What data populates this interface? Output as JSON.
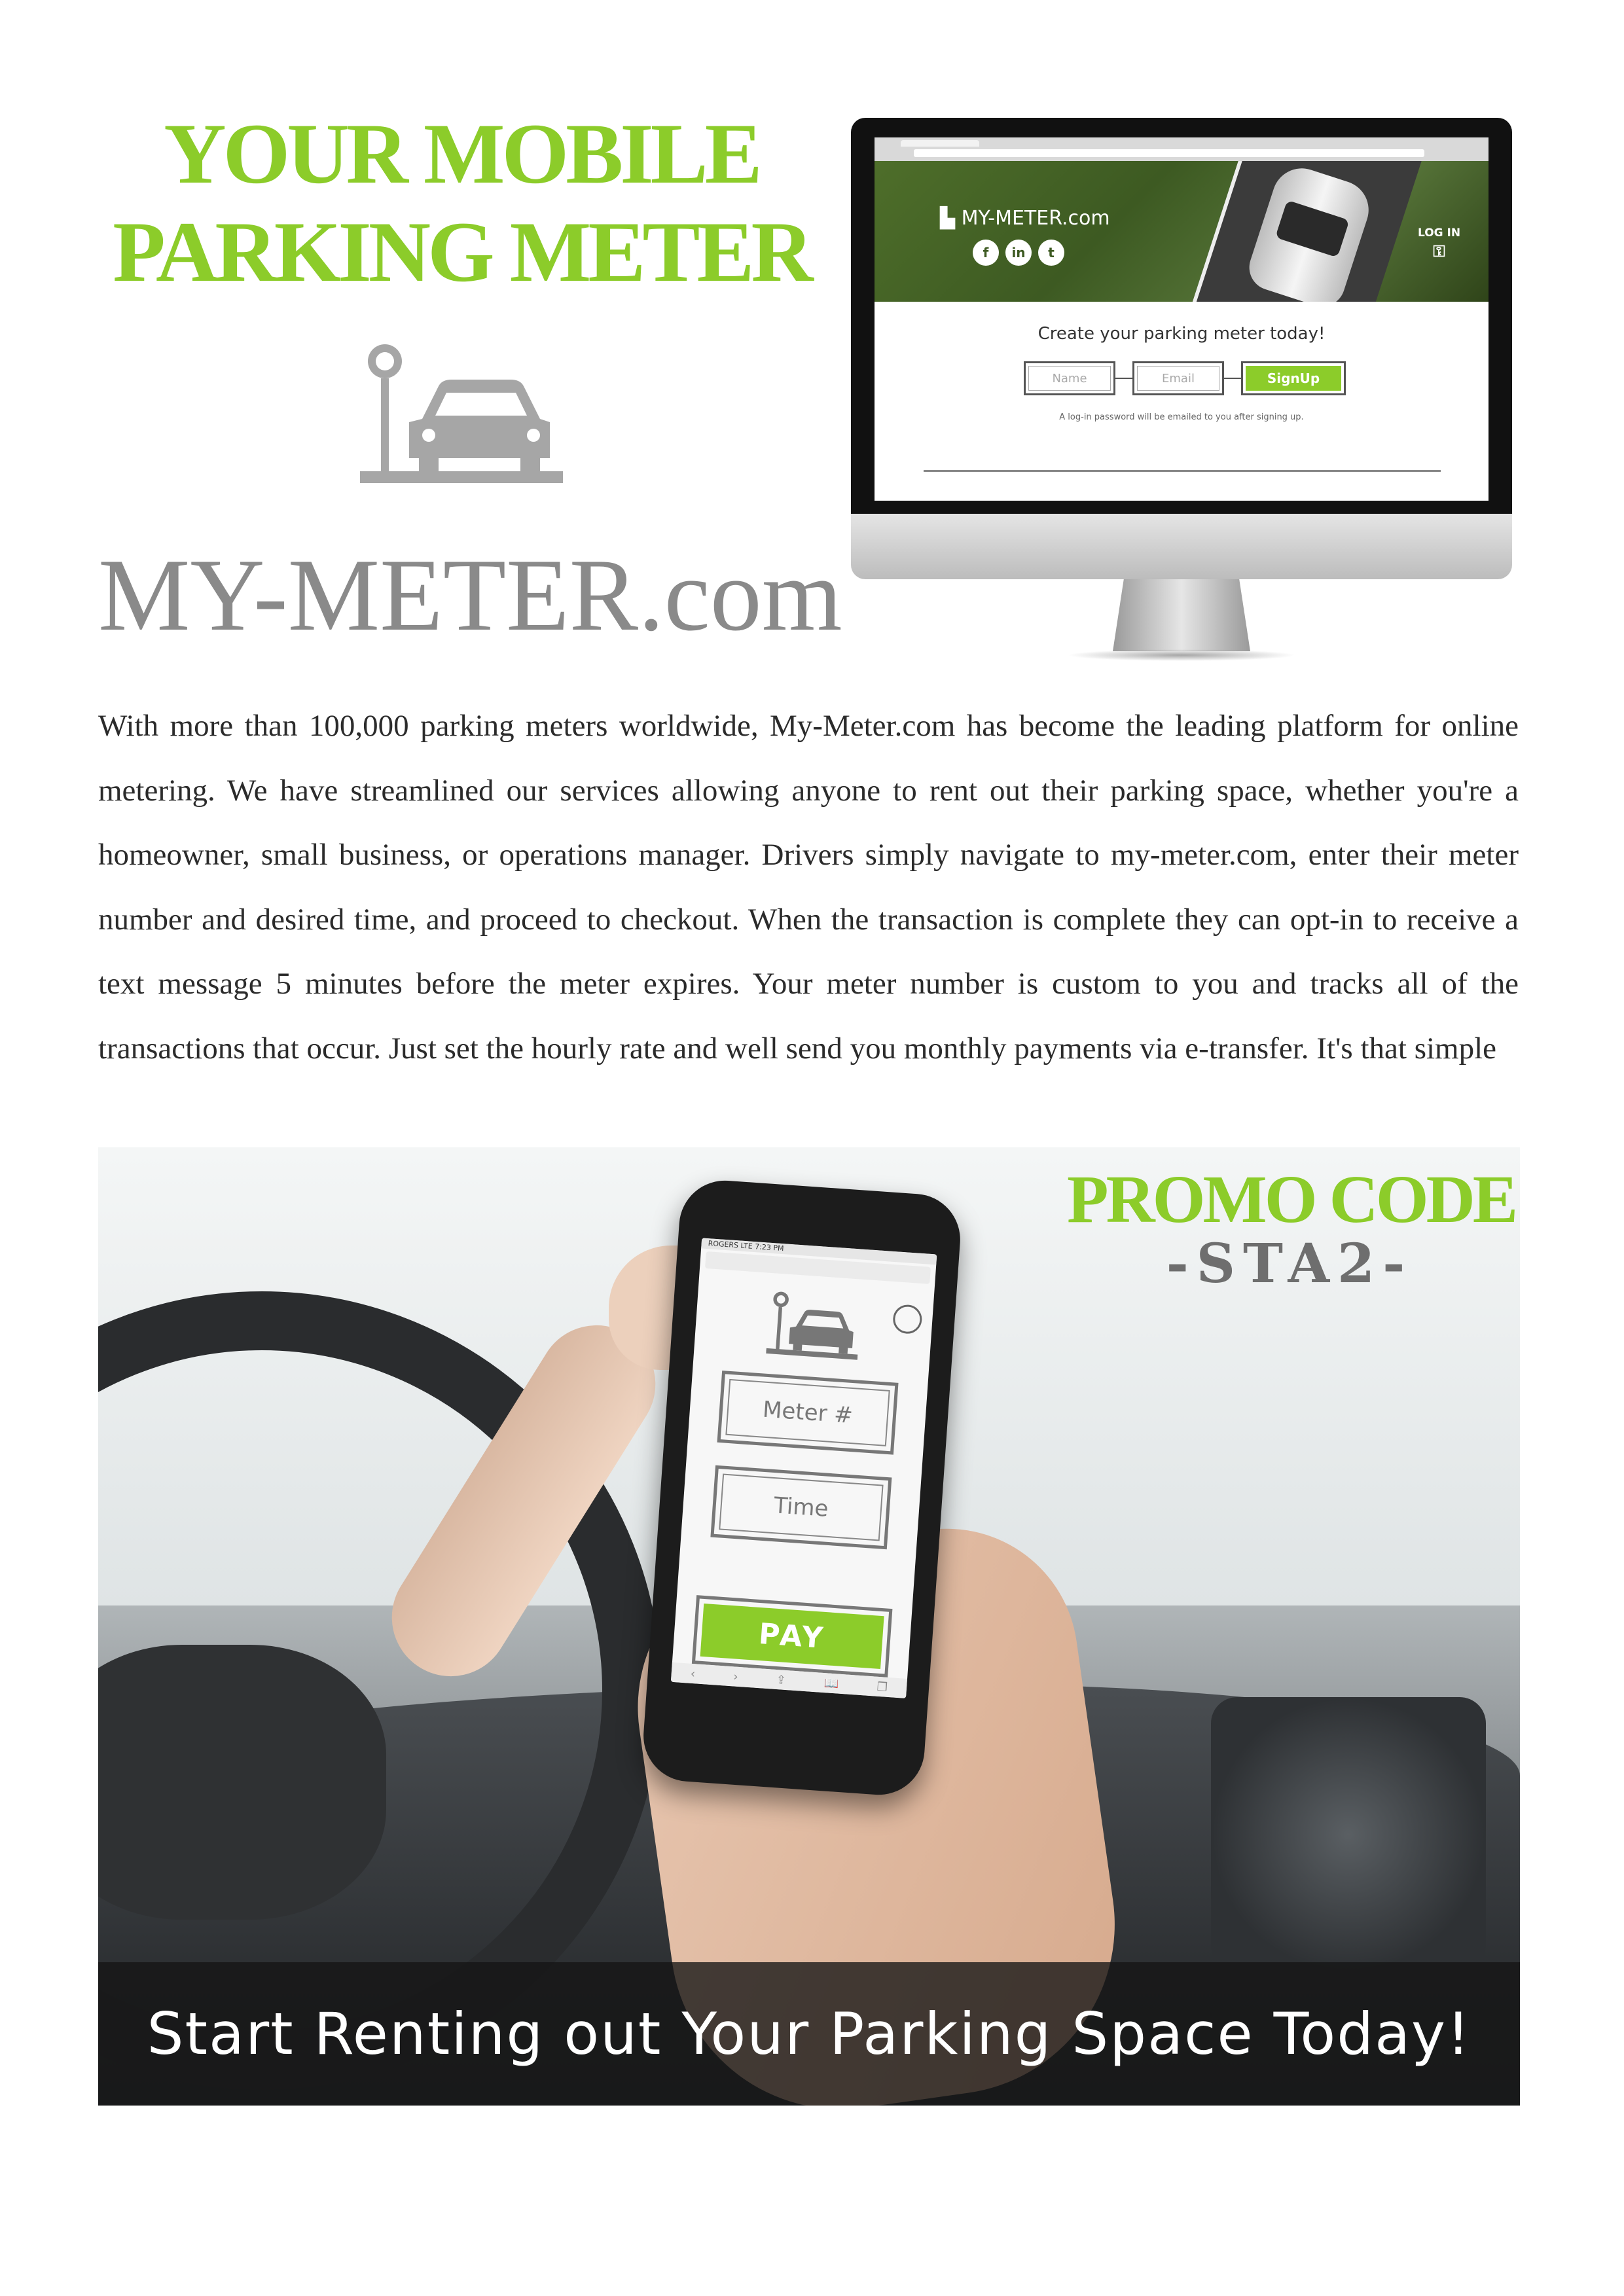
{
  "header": {
    "headline_line1": "YOUR MOBILE",
    "headline_line2": "PARKING METER",
    "brand": "MY-METER.com",
    "logo_icon": "parking-meter-car-icon"
  },
  "monitor_site": {
    "logo_text": "MY-METER.com",
    "social": [
      "f",
      "in",
      "t"
    ],
    "login_label": "LOG IN",
    "create_title": "Create your parking meter today!",
    "name_placeholder": "Name",
    "email_placeholder": "Email",
    "signup_label": "SignUp",
    "note": "A log-in password will be emailed to you after signing up."
  },
  "body": {
    "paragraph": "With more than 100,000 parking meters worldwide, My-Meter.com has become the leading platform for online metering. We have streamlined our services allowing anyone to rent out their parking space, whether you're a homeowner, small business, or operations manager. Drivers simply navigate to my-meter.com, enter their meter number and desired time, and proceed to checkout. When the transaction is complete they can opt-in to receive a text message 5 minutes before the meter expires. Your meter number is custom to you and tracks all of the transactions that occur. Just set the hourly rate and well send you monthly payments via e-transfer. It's that simple"
  },
  "promo": {
    "label": "PROMO CODE:",
    "code": "-STA2-",
    "banner": "Start Renting out Your Parking Space Today!"
  },
  "phone_app": {
    "status": "ROGERS LTE   7:23 PM",
    "meter_label": "Meter #",
    "time_label": "Time",
    "pay_label": "PAY",
    "toolbar": [
      "‹",
      "›",
      "⇪",
      "📖",
      "❐"
    ]
  },
  "colors": {
    "accent_green": "#8ccc2a",
    "brand_gray": "#8a8a8a",
    "text": "#2b2b2b"
  }
}
